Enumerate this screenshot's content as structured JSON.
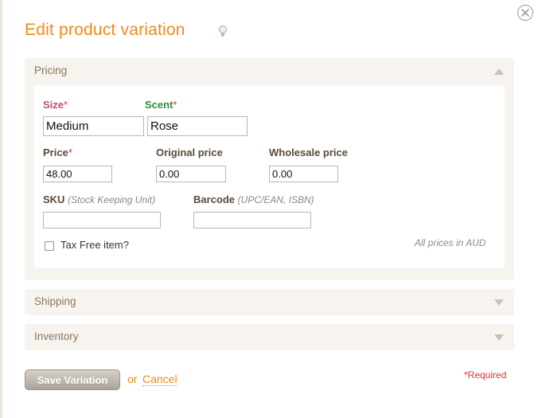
{
  "dialog": {
    "title": "Edit product variation"
  },
  "sections": {
    "pricing": {
      "label": "Pricing",
      "size": {
        "label": "Size",
        "required_mark": "*",
        "value": "Medium"
      },
      "scent": {
        "label": "Scent",
        "required_mark": "*",
        "value": "Rose"
      },
      "price": {
        "label": "Price",
        "required_mark": "*",
        "value": "48.00"
      },
      "original_price": {
        "label": "Original price",
        "value": "0.00"
      },
      "wholesale_price": {
        "label": "Wholesale price",
        "value": "0.00"
      },
      "sku": {
        "label": "SKU",
        "hint": "(Stock Keeping Unit)",
        "value": ""
      },
      "barcode": {
        "label": "Barcode",
        "hint": "(UPC/EAN, ISBN)",
        "value": ""
      },
      "tax_free": {
        "label": "Tax Free item?",
        "checked": false
      },
      "prices_note": "All prices in AUD"
    },
    "shipping": {
      "label": "Shipping"
    },
    "inventory": {
      "label": "Inventory"
    }
  },
  "footer": {
    "save_label": "Save Variation",
    "or_text": "or",
    "cancel_label": "Cancel",
    "required_note": "*Required"
  },
  "colors": {
    "accent_orange": "#f08a1c",
    "size_label": "#c0506e",
    "scent_label": "#2e8b3a",
    "required_red": "#dd3333",
    "section_bg": "#f7f3ee"
  }
}
